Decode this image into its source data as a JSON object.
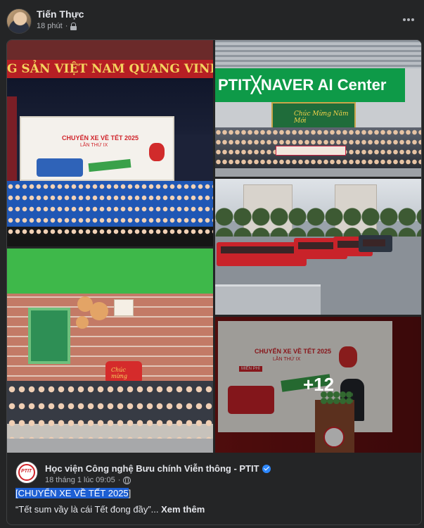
{
  "post": {
    "author": "Tiến Thực",
    "time": "18 phút",
    "separator": "·"
  },
  "shared": {
    "photos": {
      "p1_banner": "G SẢN VIỆT NAM QUANG VINH MUÔN",
      "p1_screen_title": "CHUYẾN XE VỀ TẾT 2025",
      "p1_screen_sub": "LẦN THỨ IX",
      "p2_sign": "PTIT╳NAVER AI Center",
      "p2_board": "Chúc Mừng Năm Mới",
      "p4_sticker": "Chúc mừng",
      "p5_screen_title": "CHUYẾN XE VỀ TẾT 2025",
      "p5_screen_sub": "LẦN THỨ IX",
      "p5_free": "MIỄN PHÍ",
      "more_count": "+12"
    },
    "page_name": "Học viện Công nghệ Bưu chính Viễn thông - PTIT",
    "page_logo_text": "PTIT",
    "time": "18 tháng 1 lúc 09:05",
    "separator": "·",
    "hashtag_open": "[",
    "hashtag_text": "CHUYỂN XE VỀ TẾT 2025",
    "hashtag_close": "]",
    "excerpt": "“Tết sum vầy là cái Tết đong đầy”...",
    "see_more": "Xem thêm"
  },
  "icons": {
    "privacy": "lock-icon",
    "more": "more-horizontal-icon",
    "verified": "verified-badge-icon",
    "audience": "globe-icon"
  },
  "colors": {
    "background": "#242526",
    "text": "#e4e6eb",
    "secondary_text": "#b0b3b8",
    "verified": "#2d88ff",
    "highlight": "#1d5fd3"
  }
}
